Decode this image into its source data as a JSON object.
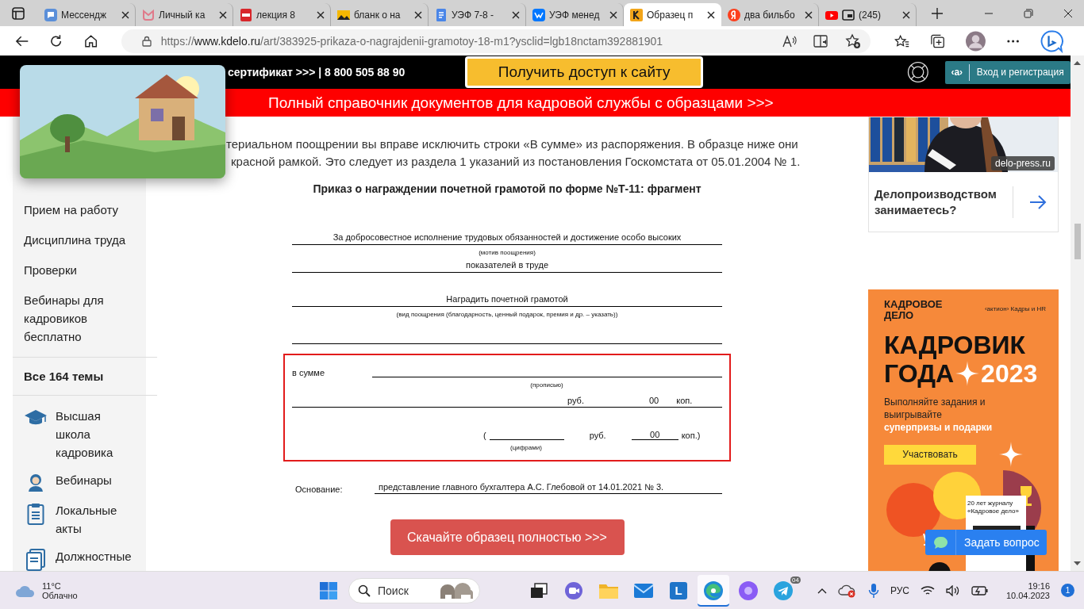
{
  "browser": {
    "tabs": [
      {
        "title": "Мессендж",
        "kind": "chat",
        "selected": false,
        "picture_in_picture": false
      },
      {
        "title": "Личный ка",
        "kind": "mail",
        "selected": false,
        "picture_in_picture": false
      },
      {
        "title": "лекция 8",
        "kind": "pdf",
        "selected": false,
        "picture_in_picture": false
      },
      {
        "title": "бланк о на",
        "selected": false,
        "picture_in_picture": false
      },
      {
        "title": "УЭФ 7-8 -",
        "kind": "docs",
        "selected": false,
        "picture_in_picture": false
      },
      {
        "title": "УЭФ менед",
        "kind": "vk",
        "selected": false,
        "picture_in_picture": false
      },
      {
        "title": "Образец п",
        "kind": "kdelo",
        "selected": true,
        "picture_in_picture": false
      },
      {
        "title": "два бильбо",
        "kind": "yandex",
        "selected": false,
        "picture_in_picture": false
      },
      {
        "title": "(245)",
        "kind": "youtube",
        "selected": false,
        "picture_in_picture": true
      }
    ],
    "address": {
      "prefix": "https://",
      "host": "www.kdelo.ru",
      "path": "/art/383925-prikaza-o-nagrajdenii-gramotoy-18-m1?ysclid=lgb18nctam392881901"
    }
  },
  "site_header": {
    "contact": "сертификат >>> | 8 800 505 88 90",
    "access_button": "Получить доступ к сайту",
    "login_mark": "‹a›",
    "login_button": "Вход и регистрация"
  },
  "banner": "Полный справочник документов для кадровой службы с образцами >>>",
  "sidebar": {
    "topics": [
      "Прием на работу",
      "Дисциплина труда",
      "Проверки",
      "Вебинары для кадровиков бесплатно"
    ],
    "all_topics": "Все 164 темы",
    "sections": [
      {
        "label": "Высшая школа кадровика",
        "kind": "graduation"
      },
      {
        "label": "Вебинары",
        "kind": "person"
      },
      {
        "label": "Локальные акты",
        "kind": "clipboard"
      },
      {
        "label": "Должностные",
        "kind": "documents"
      }
    ]
  },
  "article": {
    "intro_lines": [
      "териальном поощрении вы вправе исключить строки «В сумме» из распоряжения. В образце ниже они",
      "красной рамкой. Это следует из раздела 1 указаний из постановления Госкомстата от 05.01.2004 № 1."
    ],
    "sample_title": "Приказ о награждении почетной грамотой по форме №Т-11: фрагмент",
    "form": {
      "motive_line_1": "За добросовестное исполнение трудовых обязанностей и достижение особо высоких",
      "motive_caption": "(мотив поощрения)",
      "motive_line_2": "показателей в труде",
      "reward": "Наградить почетной грамотой",
      "reward_caption": "(вид поощрения (благодарность, ценный подарок, премия и др. – указать))",
      "sum_label": "в сумме",
      "words_caption": "(прописью)",
      "rub": "руб.",
      "kop_value": "00",
      "kop": "коп.",
      "open_paren": "(",
      "rub_2": "руб.",
      "kop_value_2": "00",
      "kop_2": "коп.)",
      "digits_caption": "(цифрами)",
      "basis_label": "Основание:",
      "basis": "представление главного бухгалтера А.С. Глебовой от 14.01.2021 № 3."
    },
    "download_button": "Скачайте образец полностью >>>"
  },
  "ads": {
    "card": {
      "badge": "delo-press.ru",
      "question": "Делопроизводством занимаетесь?"
    },
    "promo": {
      "brand": "КАДРОВОЕ ДЕЛО",
      "partner": "‹актион› Кадры и HR",
      "headline_1": "КАДРОВИК",
      "headline_2": "ГОДА",
      "year": "2023",
      "text": "Выполняйте задания и выигрывайте",
      "highlight": "суперпризы и подарки",
      "button": "Участвовать",
      "magazine": "20 лет журналу «Кадровое дело»"
    }
  },
  "chat_button": "Задать вопрос",
  "taskbar": {
    "temperature": "11°C",
    "weather": "Облачно",
    "search_placeholder": "Поиск",
    "apps": [
      {
        "kind": "taskview",
        "selected": false
      },
      {
        "kind": "video-chat",
        "selected": false
      },
      {
        "kind": "folder",
        "selected": false
      },
      {
        "kind": "mail",
        "selected": false
      },
      {
        "kind": "letter",
        "label": "L",
        "selected": false
      },
      {
        "kind": "edge",
        "selected": true
      },
      {
        "kind": "assistant",
        "selected": false
      },
      {
        "kind": "telegram",
        "badge": "04",
        "selected": false
      }
    ],
    "language": "РУС",
    "time": "19:16",
    "date": "10.04.2023",
    "notifications": "1"
  }
}
